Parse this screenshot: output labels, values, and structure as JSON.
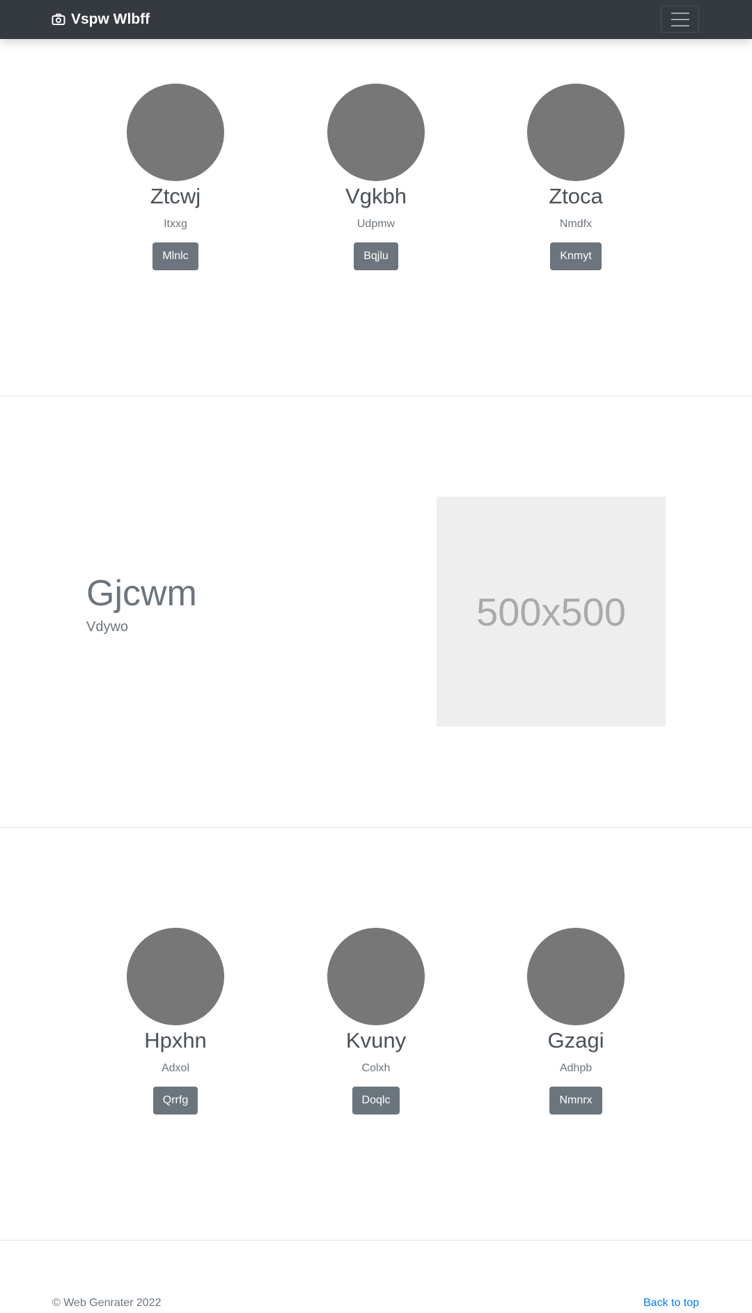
{
  "navbar": {
    "brand": "Vspw Wlbff",
    "brand_icon": "camera-icon",
    "toggle_icon": "hamburger-menu-icon"
  },
  "section1": {
    "cards": [
      {
        "name": "Ztcwj",
        "sub": "Itxxg",
        "button": "Mlnlc"
      },
      {
        "name": "Vgkbh",
        "sub": "Udpmw",
        "button": "Bqjlu"
      },
      {
        "name": "Ztoca",
        "sub": "Nmdfx",
        "button": "Knmyt"
      }
    ]
  },
  "feature": {
    "title": "Gjcwm",
    "subtitle": "Vdywo",
    "image_label": "500x500"
  },
  "section2": {
    "cards": [
      {
        "name": "Hpxhn",
        "sub": "Adxol",
        "button": "Qrrfg"
      },
      {
        "name": "Kvuny",
        "sub": "Colxh",
        "button": "Doqlc"
      },
      {
        "name": "Gzagi",
        "sub": "Adhpb",
        "button": "Nmnrx"
      }
    ]
  },
  "footer": {
    "copyright": "© Web Genrater 2022",
    "back_to_top": "Back to top"
  },
  "colors": {
    "navbar_bg": "#343a40",
    "button_bg": "#6c757d",
    "avatar": "#777777",
    "link": "#007bff"
  }
}
